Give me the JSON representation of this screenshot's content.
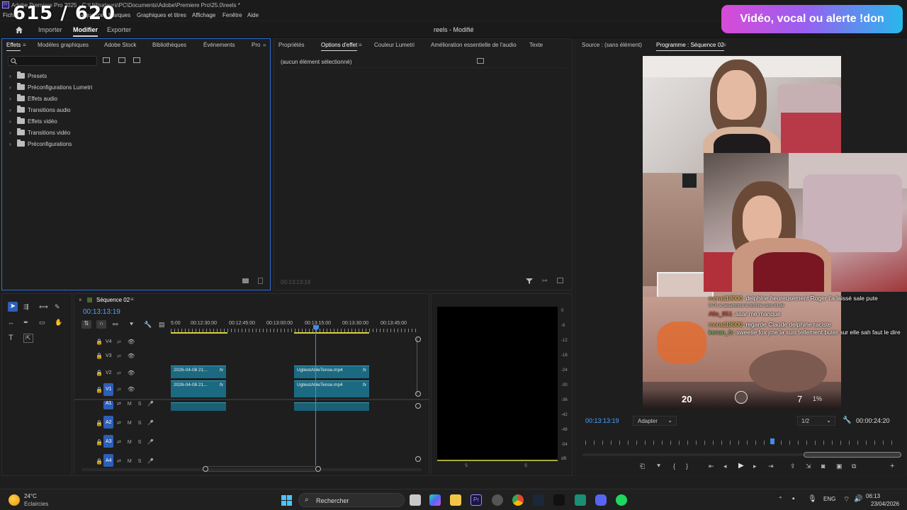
{
  "window": {
    "title": "Adobe Premiere Pro 2025 - C:\\Utilisateurs\\PC\\Documents\\Adobe\\Premiere Pro\\25.0\\reels *",
    "overlay_counter": "615 / 620",
    "menu": [
      "Fichier",
      "Modifier",
      "Séquence",
      "Marques",
      "Graphiques et titres",
      "Affichage",
      "Fenêtre",
      "Aide"
    ]
  },
  "workspace": {
    "tabs": [
      "Importer",
      "Modifier",
      "Exporter"
    ],
    "active": "Modifier",
    "project_title": "reels - Modifié"
  },
  "donation_banner": "Vidéo, vocal ou alerte !don",
  "effects_panel": {
    "tabs": [
      "Effets",
      "Modèles graphiques",
      "Adobe Stock",
      "Bibliothèques",
      "Événements",
      "Pro"
    ],
    "items": [
      "Presets",
      "Préconfigurations Lumetri",
      "Effets audio",
      "Transitions audio",
      "Effets vidéo",
      "Transitions vidéo",
      "Préconfigurations"
    ]
  },
  "effect_options_panel": {
    "tabs": [
      "Propriétés",
      "Options d'effet",
      "Couleur Lumetri",
      "Amélioration essentielle de l'audio",
      "Texte"
    ],
    "empty_label": "(aucun élément sélectionné)",
    "timecode": "00:13:13:19"
  },
  "monitor": {
    "tabs": [
      "Source : (sans élément)",
      "Programme : Séquence 02"
    ],
    "timecode": "00:13:13:19",
    "fit": "Adapter",
    "resolution": "1/2",
    "duration": "00:00:24:20",
    "chat": [
      {
        "user": "morad18000",
        "text": ": delphine heureusement Roger t'a laissé sale pute",
        "user_color": "#e8c94a"
      },
      {
        "user": "",
        "text": "R Pl; & desamorce la bombe sans kit de",
        "user_color": "#ffffff"
      },
      {
        "user": "Allo_951",
        "text": ": asar me manque",
        "user_color": "#e05050"
      },
      {
        "user": "morad18000",
        "text": ": regarde Claude delphine raciste",
        "user_color": "#e8c94a"
      },
      {
        "user": "kenan_fx",
        "text": ": sweetie fox jme la suis tellement buter sur elle sah faut le dire",
        "user_color": "#7ad36b"
      }
    ],
    "hud": {
      "health": "20",
      "ammo": "7",
      "reserve": "1%"
    }
  },
  "timeline": {
    "sequence": "Séquence 02",
    "timecode": "00:13:13:19",
    "ruler": [
      "5:00",
      "00:12:30:00",
      "00:12:45:00",
      "00:13:00:00",
      "00:13:15:00",
      "00:13:30:00",
      "00:13:45:00"
    ],
    "video_tracks": [
      "V4",
      "V3",
      "V2",
      "V1"
    ],
    "audio_tracks": [
      "A1",
      "A2",
      "A3",
      "A4"
    ],
    "clips": [
      {
        "name": "2026-04-08 21...",
        "track": "V2"
      },
      {
        "name": "UgliestAbleTense.mp4",
        "track": "V2"
      },
      {
        "name": "2026-04-08 21...",
        "track": "V1"
      },
      {
        "name": "UgliestAbleTense.mp4",
        "track": "V1"
      }
    ],
    "fx_label": "fx"
  },
  "audio_meter": {
    "scale": [
      "0",
      "-6",
      "-12",
      "-18",
      "-24",
      "-30",
      "-36",
      "-42",
      "-48",
      "-54",
      "dB"
    ],
    "channels": [
      "S",
      "S"
    ]
  },
  "taskbar": {
    "weather_temp": "24°C",
    "weather_desc": "Eclaircies",
    "search": "Rechercher",
    "lang": "ENG",
    "time": "06:13",
    "date": "23/04/2026"
  }
}
